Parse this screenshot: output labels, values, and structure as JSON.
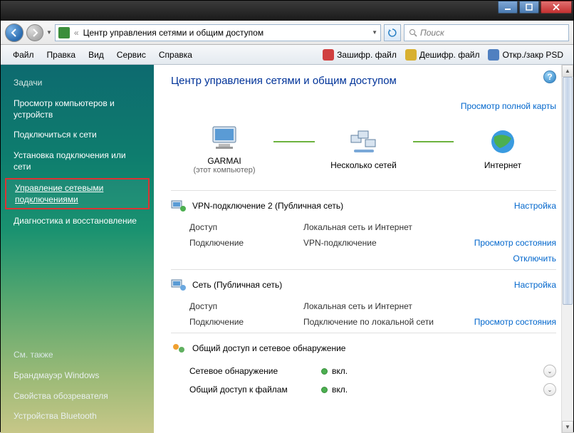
{
  "window": {
    "address_label": "Центр управления сетями и общим доступом",
    "search_placeholder": "Поиск"
  },
  "menubar": {
    "items": [
      "Файл",
      "Правка",
      "Вид",
      "Сервис",
      "Справка"
    ],
    "tools": [
      {
        "label": "Зашифр. файл",
        "icon": "lock-red-icon"
      },
      {
        "label": "Дешифр. файл",
        "icon": "lock-yellow-icon"
      },
      {
        "label": "Откр./закр PSD",
        "icon": "folder-icon"
      }
    ]
  },
  "sidebar": {
    "heading": "Задачи",
    "items": [
      "Просмотр компьютеров и устройств",
      "Подключиться к сети",
      "Установка подключения или сети",
      "Управление сетевыми подключениями",
      "Диагностика и восстановление"
    ],
    "highlighted_index": 3,
    "see_also_heading": "См. также",
    "see_also": [
      "Брандмауэр Windows",
      "Свойства обозревателя",
      "Устройства Bluetooth"
    ]
  },
  "content": {
    "title": "Центр управления сетями и общим доступом",
    "map_link": "Просмотр полной карты",
    "nodes": {
      "computer": {
        "name": "GARMAI",
        "sub": "(этот компьютер)"
      },
      "middle": {
        "name": "Несколько сетей"
      },
      "internet": {
        "name": "Интернет"
      }
    },
    "networks": [
      {
        "title": "VPN-подключение  2 (Публичная сеть)",
        "config_link": "Настройка",
        "rows": [
          {
            "k": "Доступ",
            "v": "Локальная сеть и Интернет"
          },
          {
            "k": "Подключение",
            "v": "VPN-подключение",
            "actions": [
              "Просмотр состояния",
              "Отключить"
            ]
          }
        ]
      },
      {
        "title": "Сеть (Публичная сеть)",
        "config_link": "Настройка",
        "rows": [
          {
            "k": "Доступ",
            "v": "Локальная сеть и Интернет"
          },
          {
            "k": "Подключение",
            "v": "Подключение по локальной сети",
            "actions": [
              "Просмотр состояния"
            ]
          }
        ]
      }
    ],
    "sharing": {
      "title": "Общий доступ и сетевое обнаружение",
      "rows": [
        {
          "label": "Сетевое обнаружение",
          "value": "вкл."
        },
        {
          "label": "Общий доступ к файлам",
          "value": "вкл."
        }
      ]
    }
  }
}
